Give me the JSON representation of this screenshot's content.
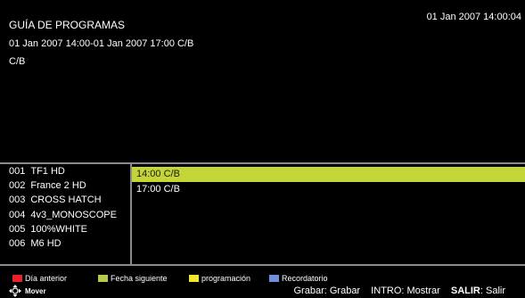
{
  "header": {
    "title": "GUÍA DE PROGRAMAS",
    "clock": "01 Jan 2007 14:00:04",
    "time_range": "01 Jan 2007 14:00-01 Jan 2007 17:00 C/B",
    "event_title": "C/B"
  },
  "channels": [
    {
      "number": "001",
      "name": "TF1  HD"
    },
    {
      "number": "002",
      "name": "France 2 HD"
    },
    {
      "number": "003",
      "name": "CROSS HATCH"
    },
    {
      "number": "004",
      "name": "4v3_MONOSCOPE"
    },
    {
      "number": "005",
      "name": "100%WHITE"
    },
    {
      "number": "006",
      "name": "M6 HD"
    }
  ],
  "schedule": [
    {
      "time_title": "14:00 C/B"
    },
    {
      "time_title": "17:00 C/B"
    }
  ],
  "legend": {
    "red_label": "Día  anterior",
    "green_label": "Fecha siguiente",
    "yellow_label": "programación",
    "blue_label": "Recordatorio",
    "move_label": "Mover",
    "record_key": "Grabar",
    "record_action": ": Grabar",
    "ok_key": "INTRO",
    "ok_action": ": Mostrar",
    "exit_key": "SALIR",
    "exit_action": ": Salir"
  },
  "colors": {
    "red": "#e8212b",
    "green": "#b5c94a",
    "yellow": "#f0ea2a",
    "blue": "#6f8fd8",
    "highlight": "#c4d537",
    "divider": "#8a8a8a"
  },
  "icons": {
    "move": "four-way-arrows-icon"
  }
}
